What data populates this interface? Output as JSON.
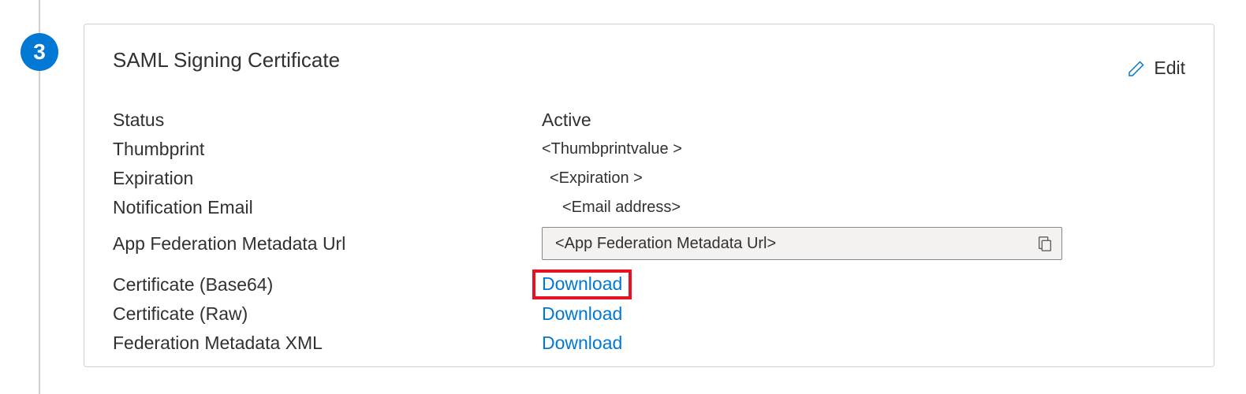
{
  "step": {
    "number": "3"
  },
  "card": {
    "title": "SAML Signing Certificate",
    "edit_label": "Edit",
    "fields": {
      "status_label": "Status",
      "status_value": "Active",
      "thumbprint_label": "Thumbprint",
      "thumbprint_value": "<Thumbprintvalue >",
      "expiration_label": "Expiration",
      "expiration_value": "<Expiration >",
      "notif_email_label": "Notification Email",
      "notif_email_value": "<Email address>",
      "fed_url_label": "App Federation Metadata Url",
      "fed_url_value": "<App Federation Metadata Url>",
      "cert_b64_label": "Certificate (Base64)",
      "cert_b64_action": "Download",
      "cert_raw_label": "Certificate (Raw)",
      "cert_raw_action": "Download",
      "fed_xml_label": "Federation Metadata XML",
      "fed_xml_action": "Download"
    }
  }
}
